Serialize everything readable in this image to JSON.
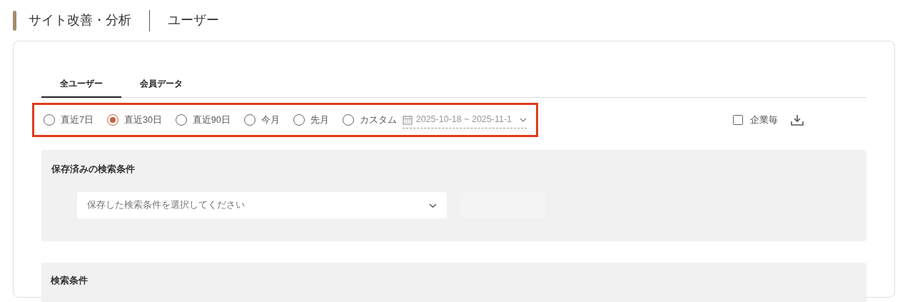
{
  "header": {
    "section": "サイト改善・分析",
    "page": "ユーザー"
  },
  "tabs": [
    {
      "label": "全ユーザー",
      "selected": true
    },
    {
      "label": "会員データ",
      "selected": false
    }
  ],
  "period_options": [
    {
      "label": "直近7日",
      "selected": false
    },
    {
      "label": "直近30日",
      "selected": true
    },
    {
      "label": "直近90日",
      "selected": false
    },
    {
      "label": "今月",
      "selected": false
    },
    {
      "label": "先月",
      "selected": false
    },
    {
      "label": "カスタム",
      "selected": false
    }
  ],
  "date_range": {
    "value": "2025-10-18 ~ 2025-11-1"
  },
  "period_highlighted": true,
  "per_company": {
    "label": "企業毎",
    "checked": false
  },
  "saved_conditions": {
    "title": "保存済みの検索条件",
    "placeholder": "保存した検索条件を選択してください"
  },
  "search_conditions": {
    "title": "検索条件"
  }
}
